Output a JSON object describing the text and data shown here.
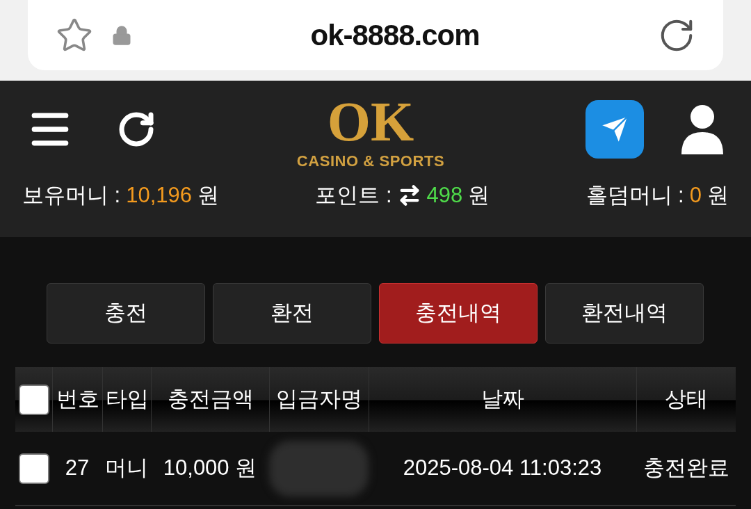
{
  "browser": {
    "url": "ok-8888.com"
  },
  "logo": {
    "mark": "OK",
    "tagline": "CASINO & SPORTS"
  },
  "balances": [
    {
      "label": "보유머니 :",
      "value": "10,196",
      "unit": "원",
      "color": "#f39a1e",
      "transfer": false
    },
    {
      "label": "포인트 :",
      "value": "498",
      "unit": "원",
      "color": "#4fdc4a",
      "transfer": true
    },
    {
      "label": "홀덤머니 :",
      "value": "0",
      "unit": "원",
      "color": "#f39a1e",
      "transfer": false
    }
  ],
  "tabs": [
    {
      "label": "충전",
      "selected": false
    },
    {
      "label": "환전",
      "selected": false
    },
    {
      "label": "충전내역",
      "selected": true
    },
    {
      "label": "환전내역",
      "selected": false
    }
  ],
  "table": {
    "select_all": {
      "checked": false
    },
    "columns": [
      "번호",
      "타입",
      "충전금액",
      "입금자명",
      "날짜",
      "상태"
    ],
    "rows": [
      {
        "checked": false,
        "cells": [
          "27",
          "머니",
          "10,000 원",
          "",
          "2025-08-04 11:03:23",
          "충전완료"
        ],
        "redacted": true
      }
    ]
  }
}
